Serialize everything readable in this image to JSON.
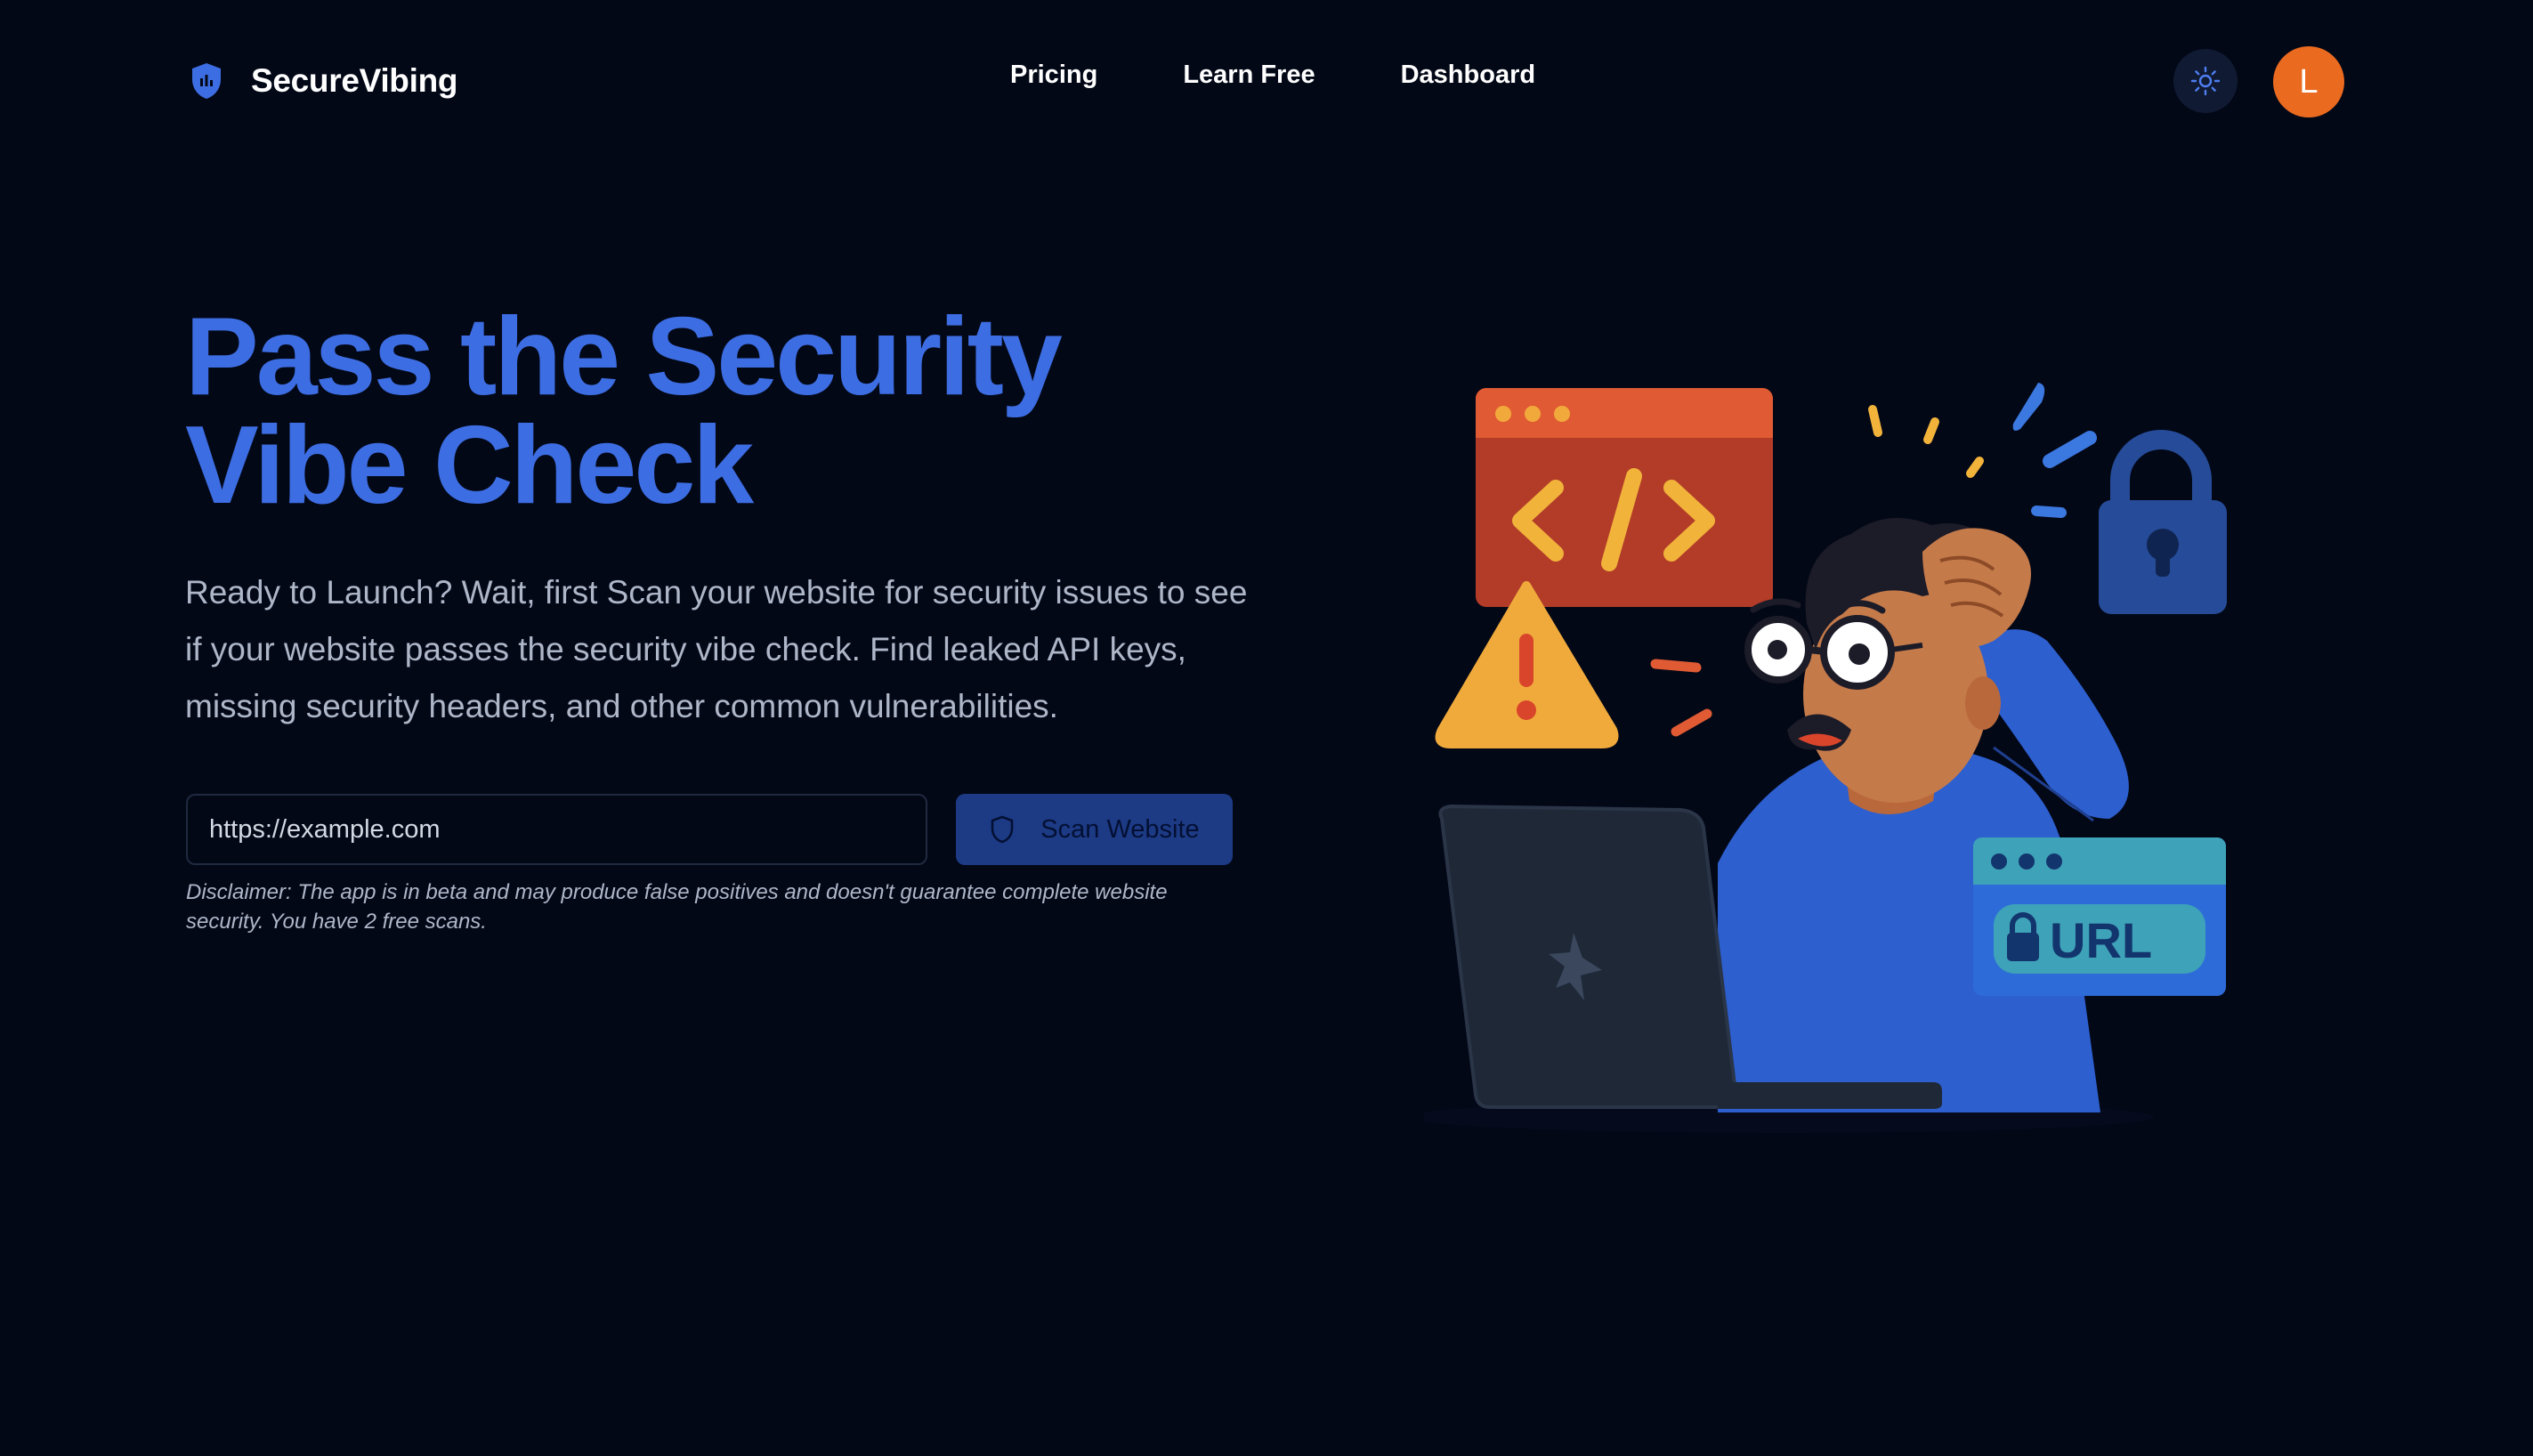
{
  "header": {
    "brand_name": "SecureVibing",
    "nav": [
      "Pricing",
      "Learn Free",
      "Dashboard"
    ],
    "avatar_initial": "L"
  },
  "hero": {
    "title_line1": "Pass the Security",
    "title_line2": "Vibe Check",
    "description": "Ready to Launch? Wait, first Scan your website for security issues to see if your website passes the security vibe check. Find leaked API keys, missing security headers, and other common vulnerabilities.",
    "url_placeholder": "https://example.com",
    "scan_button_label": "Scan Website",
    "disclaimer": "Disclaimer: The app is in beta and may produce false positives and doesn't guarantee complete website security. You have 2 free scans."
  },
  "illustration": {
    "url_badge_text": "URL",
    "code_symbol": "</>"
  },
  "colors": {
    "background": "#030817",
    "accent": "#3d6de2",
    "avatar": "#ea6a1f",
    "button": "#1d3a85"
  },
  "icons": {
    "brand": "shield-icon",
    "theme_toggle": "sun-icon",
    "scan_button": "shield-outline-icon"
  }
}
